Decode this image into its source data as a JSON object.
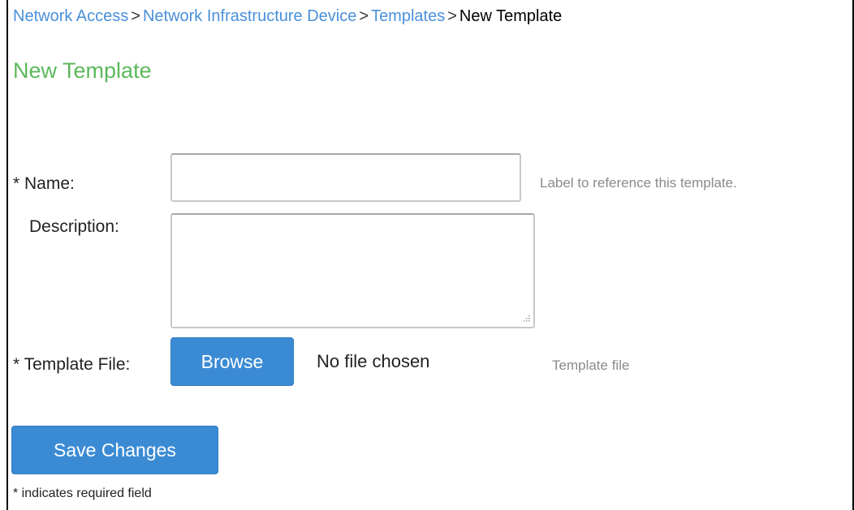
{
  "breadcrumb": {
    "items": [
      "Network Access",
      "Network Infrastructure Device",
      "Templates"
    ],
    "current": "New Template",
    "separator": ">"
  },
  "page": {
    "title": "New Template"
  },
  "form": {
    "name": {
      "label": "* Name:",
      "value": "",
      "hint": "Label to reference this template."
    },
    "description": {
      "label": "Description:",
      "value": ""
    },
    "template_file": {
      "label": "* Template File:",
      "browse_label": "Browse",
      "status": "No file chosen",
      "hint": "Template file"
    },
    "save_label": "Save Changes",
    "required_note": "* indicates required field"
  },
  "colors": {
    "link": "#4a90d9",
    "title": "#5cb85c",
    "button": "#3b8bd4",
    "hint": "#8a8a8a"
  },
  "icons": {
    "resize": "resize-grip-icon"
  }
}
